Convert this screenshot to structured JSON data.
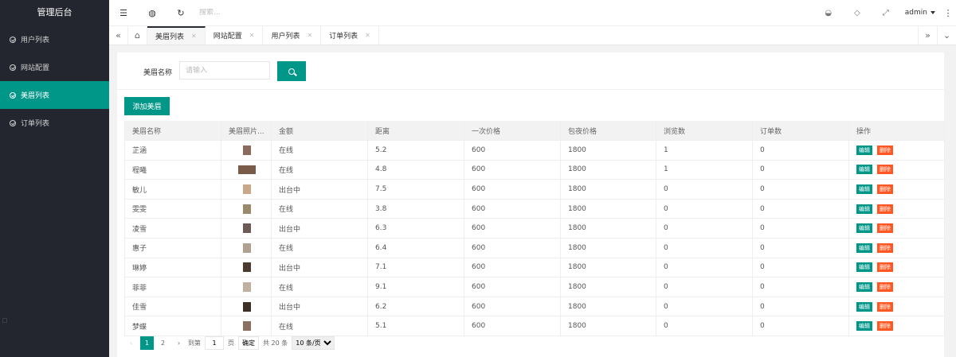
{
  "app": {
    "title": "管理后台"
  },
  "sidebar": {
    "items": [
      {
        "label": "用户列表"
      },
      {
        "label": "网站配置"
      },
      {
        "label": "美眉列表"
      },
      {
        "label": "订单列表"
      }
    ]
  },
  "header": {
    "search_placeholder": "搜索...",
    "user": "admin"
  },
  "tabs": [
    {
      "label": "美眉列表"
    },
    {
      "label": "网站配置"
    },
    {
      "label": "用户列表"
    },
    {
      "label": "订单列表"
    }
  ],
  "filter": {
    "label": "美眉名称",
    "placeholder": "请输入"
  },
  "add_button": "添加美眉",
  "table": {
    "headers": [
      "美眉名称",
      "美眉照片...",
      "金额",
      "距离",
      "一次价格",
      "包夜价格",
      "浏览数",
      "订单数",
      "操作"
    ],
    "edit_label": "编辑",
    "delete_label": "删除",
    "rows": [
      {
        "name": "芷涵",
        "status": "在线",
        "distance": "5.2",
        "price_once": "600",
        "price_night": "1800",
        "views": "1",
        "orders": "0",
        "photo": "#8a6a5a"
      },
      {
        "name": "程曦",
        "status": "在线",
        "distance": "4.8",
        "price_once": "600",
        "price_night": "1800",
        "views": "1",
        "orders": "0",
        "photo": "#7a5a48"
      },
      {
        "name": "敏儿",
        "status": "出台中",
        "distance": "7.5",
        "price_once": "600",
        "price_night": "1800",
        "views": "0",
        "orders": "0",
        "photo": "#c9a88a"
      },
      {
        "name": "雯雯",
        "status": "在线",
        "distance": "3.8",
        "price_once": "600",
        "price_night": "1800",
        "views": "0",
        "orders": "0",
        "photo": "#9a8a6a"
      },
      {
        "name": "凌雪",
        "status": "出台中",
        "distance": "6.3",
        "price_once": "600",
        "price_night": "1800",
        "views": "0",
        "orders": "0",
        "photo": "#6e5a55"
      },
      {
        "name": "惠子",
        "status": "在线",
        "distance": "6.4",
        "price_once": "600",
        "price_night": "1800",
        "views": "0",
        "orders": "0",
        "photo": "#b0a090"
      },
      {
        "name": "琳婷",
        "status": "出台中",
        "distance": "7.1",
        "price_once": "600",
        "price_night": "1800",
        "views": "0",
        "orders": "0",
        "photo": "#4a3a30"
      },
      {
        "name": "菲菲",
        "status": "在线",
        "distance": "9.1",
        "price_once": "600",
        "price_night": "1800",
        "views": "0",
        "orders": "0",
        "photo": "#c0b0a0"
      },
      {
        "name": "佳雪",
        "status": "出台中",
        "distance": "6.2",
        "price_once": "600",
        "price_night": "1800",
        "views": "0",
        "orders": "0",
        "photo": "#3a3028"
      },
      {
        "name": "梦蝶",
        "status": "在线",
        "distance": "5.1",
        "price_once": "600",
        "price_night": "1800",
        "views": "0",
        "orders": "0",
        "photo": "#8a7060"
      }
    ]
  },
  "pagination": {
    "pages": [
      "1",
      "2"
    ],
    "goto_label": "到第",
    "goto_value": "1",
    "page_unit": "页",
    "confirm": "确定",
    "total": "共 20 条",
    "per_page": "10 条/页"
  }
}
